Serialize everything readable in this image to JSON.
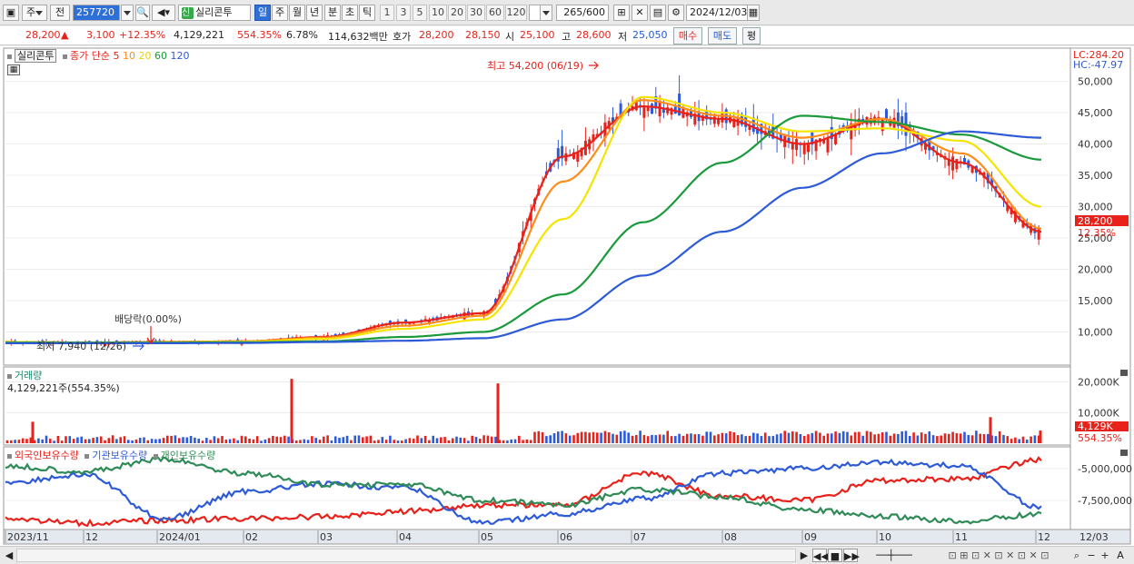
{
  "toolbar": {
    "period_label": "주",
    "prev_label": "전",
    "code": "257720",
    "credit_badge": "신",
    "stock_name": "실리콘투",
    "periods": [
      "일",
      "주",
      "월",
      "년",
      "분",
      "초",
      "틱"
    ],
    "selected_period": "일",
    "intervals": [
      "1",
      "3",
      "5",
      "10",
      "20",
      "30",
      "60",
      "120"
    ],
    "count_value": "265",
    "count_total": "/600",
    "date": "2024/12/03"
  },
  "info": {
    "price": "28,200",
    "change": "3,100",
    "change_pct": "+12.35%",
    "volume": "4,129,221",
    "volume_pct": "554.35%",
    "turnover": "6.78%",
    "amount": "114,632백만",
    "quote_label": "호가",
    "ask": "28,200",
    "bid": "28,150",
    "open_label": "시",
    "open": "25,100",
    "high_label": "고",
    "high": "28,600",
    "low_label": "저",
    "low": "25,050",
    "buy_label": "매수",
    "sell_label": "매도",
    "flat_label": "평"
  },
  "price_panel": {
    "name": "실리콘투",
    "ma_label": "종가 단순",
    "ma_periods": [
      "5",
      "10",
      "20",
      "60",
      "120"
    ],
    "ma_colors": [
      "#e8221a",
      "#ff8c1a",
      "#f5e400",
      "#1a9a3a",
      "#2d5bd8"
    ],
    "lc": "LC:284.20",
    "hc": "HC:-47.97",
    "high_annotation": "최고 54,200 (06/19)",
    "low_annotation": "최저 7,940 (12/26)",
    "dividend_annotation": "배당락(0.00%)",
    "y_ticks": [
      "50,000",
      "45,000",
      "40,000",
      "35,000",
      "30,000",
      "25,000",
      "20,000",
      "15,000",
      "10,000"
    ],
    "last_price_tag": "28,200",
    "last_pct_tag": "12.35%"
  },
  "volume_panel": {
    "title": "거래량",
    "value": "4,129,221주(554.35%)",
    "y_ticks": [
      "20,000K",
      "10,000K"
    ],
    "last_tag": "4,129K",
    "last_pct": "554.35%"
  },
  "holdings_panel": {
    "legend": [
      "외국인보유수량",
      "기관보유수량",
      "개인보유수량"
    ],
    "colors": [
      "#e8221a",
      "#2d5bd8",
      "#2e8b57"
    ],
    "y_ticks": [
      "-5,000,000",
      "-7,500,000"
    ]
  },
  "x_axis": {
    "labels": [
      "2023/11",
      "12",
      "2024/01",
      "02",
      "03",
      "04",
      "05",
      "06",
      "07",
      "08",
      "09",
      "10",
      "11",
      "12"
    ],
    "right_label": "12/03"
  },
  "chart_data": {
    "type": "line",
    "title": "",
    "xlabel": "",
    "ylabel": "",
    "x": [
      "2023/11",
      "12",
      "2024/01",
      "02",
      "03",
      "04",
      "05",
      "06",
      "07",
      "08",
      "09",
      "10",
      "11",
      "12"
    ],
    "ylim": [
      5000,
      55000
    ],
    "series": [
      {
        "name": "5",
        "values": [
          8400,
          8300,
          8400,
          8500,
          9200,
          11500,
          13000,
          38000,
          46000,
          44000,
          40000,
          44000,
          37000,
          26000
        ]
      },
      {
        "name": "10",
        "values": [
          8400,
          8300,
          8400,
          8500,
          9100,
          11000,
          12600,
          34000,
          47000,
          44500,
          41000,
          44000,
          38500,
          26500
        ]
      },
      {
        "name": "20",
        "values": [
          8400,
          8300,
          8350,
          8450,
          8900,
          10500,
          12000,
          28000,
          47500,
          45000,
          42000,
          42500,
          40500,
          30000
        ]
      },
      {
        "name": "60",
        "values": [
          8300,
          8300,
          8300,
          8350,
          8500,
          9200,
          10000,
          16000,
          27500,
          37000,
          44500,
          43500,
          41500,
          37500
        ]
      },
      {
        "name": "120",
        "values": [
          8200,
          8200,
          8200,
          8250,
          8400,
          8600,
          9000,
          12000,
          19000,
          26000,
          33000,
          38500,
          42000,
          41000
        ]
      }
    ]
  }
}
